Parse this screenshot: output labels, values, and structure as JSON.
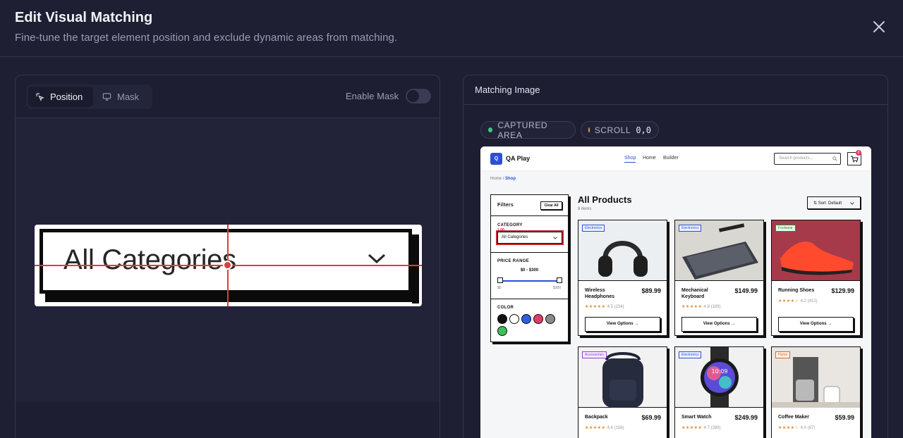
{
  "header": {
    "title": "Edit Visual Matching",
    "subtitle": "Fine-tune the target element position and exclude dynamic areas from matching."
  },
  "left_panel": {
    "tabs": [
      {
        "label": "Position",
        "icon": "pointer-click-icon",
        "active": true
      },
      {
        "label": "Mask",
        "icon": "monitor-icon",
        "active": false
      }
    ],
    "enable_mask_label": "Enable Mask",
    "enable_mask_on": false,
    "zoom_text": "All Categories"
  },
  "right_panel": {
    "title": "Matching Image",
    "captured_label": "CAPTURED AREA",
    "scroll_label": "SCROLL",
    "scroll_value": "0,0",
    "colors": {
      "captured": "#3fc48a",
      "scroll": "#e9a23b",
      "accent": "#2d4fd6",
      "highlight": "#e23b3b"
    }
  },
  "shop": {
    "logo": "Q",
    "name": "QA Play",
    "nav": [
      "Shop",
      "Home",
      "Builder"
    ],
    "search_placeholder": "Search products...",
    "cart_count": "0",
    "breadcrumb": {
      "home": "Home",
      "sep": "/",
      "current": "Shop"
    },
    "filters": {
      "title": "Filters",
      "clear": "Clear All",
      "category_label": "CATEGORY",
      "category_value": "All Categories",
      "crop_label": "1,00",
      "price_label": "PRICE RANGE",
      "price_value": "$0 - $300",
      "price_min": "$0",
      "price_max": "$300",
      "color_label": "COLOR",
      "swatches": [
        "#111111",
        "#ffffff",
        "#2f5de0",
        "#e23b6a",
        "#8a8a8a",
        "#3fbf5a"
      ]
    },
    "heading": "All Products",
    "item_count": "8 items",
    "sort": "Sort: Default",
    "products": [
      {
        "tag": "Electronics",
        "name": "Wireless Headphones",
        "price": "$89.99",
        "stars": "★★★★★",
        "rating": "4.5 (234)",
        "button": "View Options →"
      },
      {
        "tag": "Electronics",
        "name": "Mechanical Keyboard",
        "price": "$149.99",
        "stars": "★★★★★",
        "rating": "4.8 (189)",
        "button": "View Options →"
      },
      {
        "tag": "Footwear",
        "name": "Running Shoes",
        "price": "$129.99",
        "stars": "★★★★☆",
        "rating": "4.2 (412)",
        "button": "View Options →"
      },
      {
        "tag": "Accessories",
        "name": "Backpack",
        "price": "$69.99",
        "stars": "★★★★★",
        "rating": "4.6 (156)"
      },
      {
        "tag": "Electronics",
        "name": "Smart Watch",
        "price": "$249.99",
        "stars": "★★★★★",
        "rating": "4.7 (289)",
        "watch_time": "10:09"
      },
      {
        "tag": "Home",
        "name": "Coffee Maker",
        "price": "$59.99",
        "stars": "★★★★☆",
        "rating": "4.0 (87)"
      }
    ]
  }
}
